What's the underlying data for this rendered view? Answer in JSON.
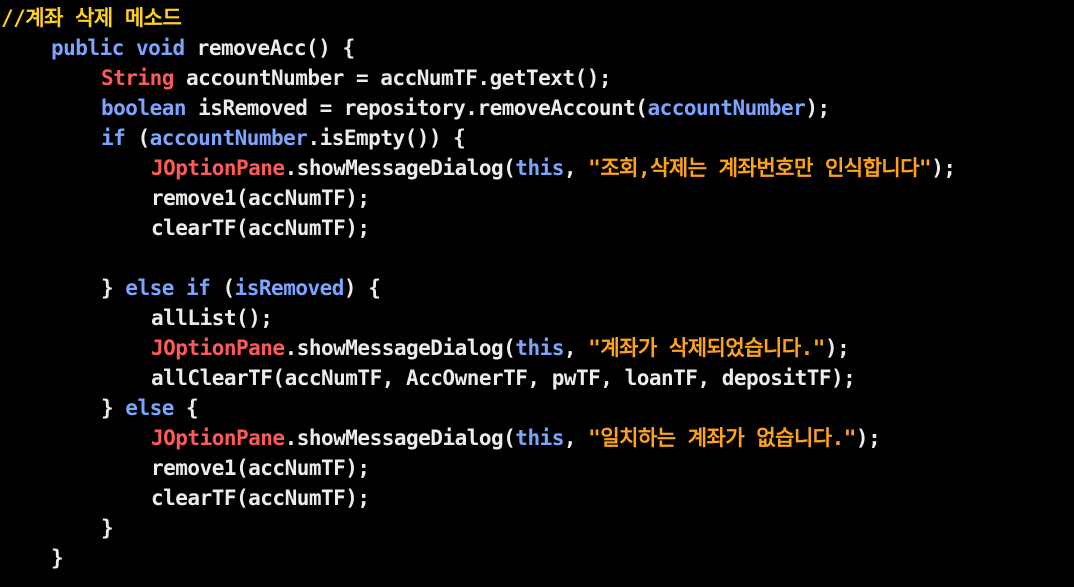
{
  "colors": {
    "background": "#000000",
    "comment": "#ffd21a",
    "keyword": "#7aa6ff",
    "type": "#ff5a5a",
    "string": "#ffa316",
    "plain": "#ececec"
  },
  "code_lines": [
    {
      "indent": 0,
      "tokens": [
        {
          "t": "comment",
          "v": "//계좌 삭제 메소드"
        }
      ]
    },
    {
      "indent": 1,
      "tokens": [
        {
          "t": "keyword",
          "v": "public"
        },
        {
          "t": "plain",
          "v": " "
        },
        {
          "t": "keyword",
          "v": "void"
        },
        {
          "t": "plain",
          "v": " removeAcc() {"
        }
      ]
    },
    {
      "indent": 2,
      "tokens": [
        {
          "t": "type",
          "v": "String"
        },
        {
          "t": "plain",
          "v": " accountNumber = accNumTF.getText();"
        }
      ]
    },
    {
      "indent": 2,
      "tokens": [
        {
          "t": "keyword",
          "v": "boolean"
        },
        {
          "t": "plain",
          "v": " isRemoved = repository.removeAccount("
        },
        {
          "t": "var",
          "v": "accountNumber"
        },
        {
          "t": "plain",
          "v": ");"
        }
      ]
    },
    {
      "indent": 2,
      "tokens": [
        {
          "t": "keyword",
          "v": "if"
        },
        {
          "t": "plain",
          "v": " ("
        },
        {
          "t": "var",
          "v": "accountNumber"
        },
        {
          "t": "plain",
          "v": ".isEmpty()) {"
        }
      ]
    },
    {
      "indent": 3,
      "tokens": [
        {
          "t": "class",
          "v": "JOptionPane"
        },
        {
          "t": "plain",
          "v": ".showMessageDialog("
        },
        {
          "t": "keyword",
          "v": "this"
        },
        {
          "t": "plain",
          "v": ", "
        },
        {
          "t": "string",
          "v": "\"조회,삭제는 계좌번호만 인식합니다\""
        },
        {
          "t": "plain",
          "v": ");"
        }
      ]
    },
    {
      "indent": 3,
      "tokens": [
        {
          "t": "plain",
          "v": "remove1(accNumTF);"
        }
      ]
    },
    {
      "indent": 3,
      "tokens": [
        {
          "t": "plain",
          "v": "clearTF(accNumTF);"
        }
      ]
    },
    {
      "indent": 0,
      "tokens": []
    },
    {
      "indent": 2,
      "tokens": [
        {
          "t": "plain",
          "v": "} "
        },
        {
          "t": "keyword",
          "v": "else"
        },
        {
          "t": "plain",
          "v": " "
        },
        {
          "t": "keyword",
          "v": "if"
        },
        {
          "t": "plain",
          "v": " ("
        },
        {
          "t": "var",
          "v": "isRemoved"
        },
        {
          "t": "plain",
          "v": ") {"
        }
      ]
    },
    {
      "indent": 3,
      "tokens": [
        {
          "t": "plain",
          "v": "allList();"
        }
      ]
    },
    {
      "indent": 3,
      "tokens": [
        {
          "t": "class",
          "v": "JOptionPane"
        },
        {
          "t": "plain",
          "v": ".showMessageDialog("
        },
        {
          "t": "keyword",
          "v": "this"
        },
        {
          "t": "plain",
          "v": ", "
        },
        {
          "t": "string",
          "v": "\"계좌가 삭제되었습니다.\""
        },
        {
          "t": "plain",
          "v": ");"
        }
      ]
    },
    {
      "indent": 3,
      "tokens": [
        {
          "t": "plain",
          "v": "allClearTF(accNumTF, AccOwnerTF, pwTF, loanTF, depositTF);"
        }
      ]
    },
    {
      "indent": 2,
      "tokens": [
        {
          "t": "plain",
          "v": "} "
        },
        {
          "t": "keyword",
          "v": "else"
        },
        {
          "t": "plain",
          "v": " {"
        }
      ]
    },
    {
      "indent": 3,
      "tokens": [
        {
          "t": "class",
          "v": "JOptionPane"
        },
        {
          "t": "plain",
          "v": ".showMessageDialog("
        },
        {
          "t": "keyword",
          "v": "this"
        },
        {
          "t": "plain",
          "v": ", "
        },
        {
          "t": "string",
          "v": "\"일치하는 계좌가 없습니다.\""
        },
        {
          "t": "plain",
          "v": ");"
        }
      ]
    },
    {
      "indent": 3,
      "tokens": [
        {
          "t": "plain",
          "v": "remove1(accNumTF);"
        }
      ]
    },
    {
      "indent": 3,
      "tokens": [
        {
          "t": "plain",
          "v": "clearTF(accNumTF);"
        }
      ]
    },
    {
      "indent": 2,
      "tokens": [
        {
          "t": "plain",
          "v": "}"
        }
      ]
    },
    {
      "indent": 1,
      "tokens": [
        {
          "t": "plain",
          "v": "}"
        }
      ]
    }
  ]
}
